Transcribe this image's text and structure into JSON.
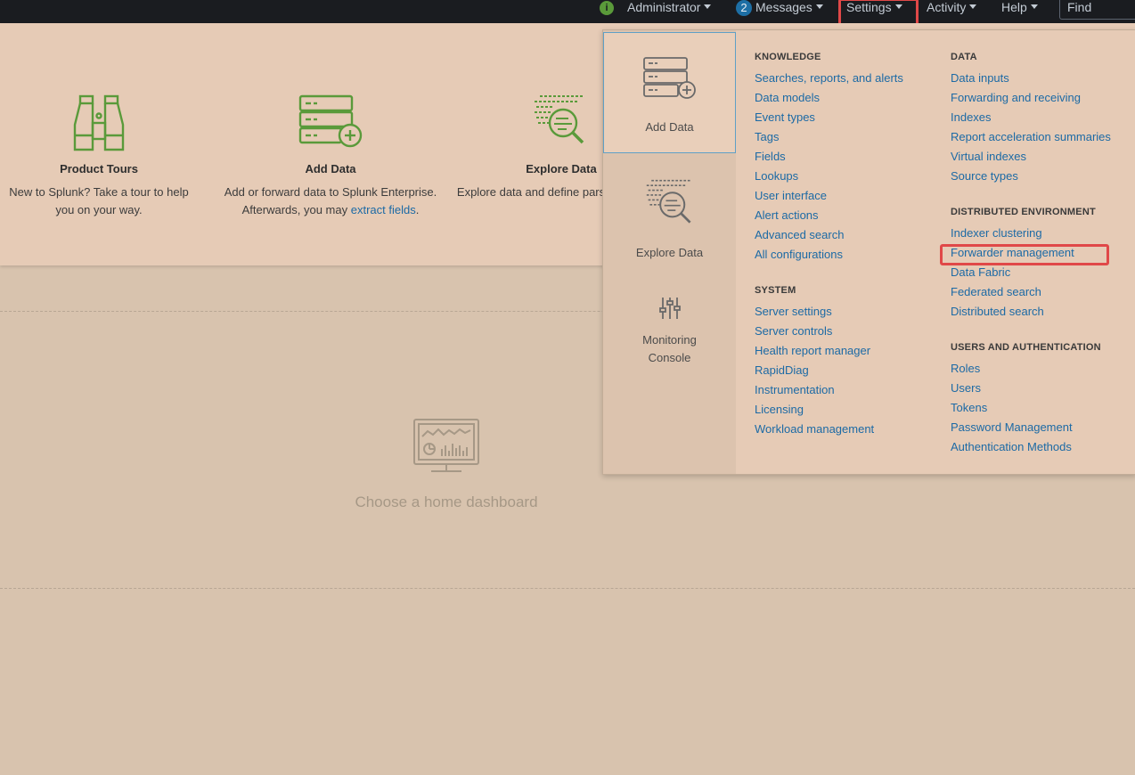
{
  "topbar": {
    "info_icon_glyph": "i",
    "user_menu": "Administrator",
    "messages_count": "2",
    "messages_menu": "Messages",
    "settings_menu": "Settings",
    "activity_menu": "Activity",
    "help_menu": "Help",
    "find_placeholder": "Find"
  },
  "welcome": {
    "tiles": [
      {
        "title": "Product Tours",
        "desc": "New to Splunk? Take a tour to help you on your way.",
        "icon": "binoculars-icon"
      },
      {
        "title": "Add Data",
        "desc_before": "Add or forward data to Splunk Enterprise. Afterwards, you may",
        "desc_link": "extract fields",
        "desc_after": ".",
        "icon": "server-add-icon"
      },
      {
        "title": "Explore Data",
        "desc": "Explore data and define parses that data",
        "icon": "explore-data-icon"
      }
    ]
  },
  "home_dashboard": {
    "text": "Choose a home dashboard",
    "icon": "monitor-dashboard-icon"
  },
  "settings_dropdown": {
    "quick_items": [
      {
        "label": "Add Data",
        "icon": "server-add-icon"
      },
      {
        "label": "Explore Data",
        "icon": "explore-data-icon"
      },
      {
        "label_line1": "Monitoring",
        "label_line2": "Console",
        "icon": "sliders-icon"
      }
    ],
    "knowledge": {
      "heading": "KNOWLEDGE",
      "items": [
        "Searches, reports, and alerts",
        "Data models",
        "Event types",
        "Tags",
        "Fields",
        "Lookups",
        "User interface",
        "Alert actions",
        "Advanced search",
        "All configurations"
      ]
    },
    "system": {
      "heading": "SYSTEM",
      "items": [
        "Server settings",
        "Server controls",
        "Health report manager",
        "RapidDiag",
        "Instrumentation",
        "Licensing",
        "Workload management"
      ]
    },
    "data": {
      "heading": "DATA",
      "items": [
        "Data inputs",
        "Forwarding and receiving",
        "Indexes",
        "Report acceleration summaries",
        "Virtual indexes",
        "Source types"
      ]
    },
    "distributed": {
      "heading": "DISTRIBUTED ENVIRONMENT",
      "items": [
        "Indexer clustering",
        "Forwarder management",
        "Data Fabric",
        "Federated search",
        "Distributed search"
      ]
    },
    "users": {
      "heading": "USERS AND AUTHENTICATION",
      "items": [
        "Roles",
        "Users",
        "Tokens",
        "Password Management",
        "Authentication Methods"
      ]
    }
  },
  "colors": {
    "link": "#1c6aa5",
    "icon_green": "#5a9a3a",
    "highlight_red": "#e04848",
    "topbar": "#1a1c20"
  }
}
